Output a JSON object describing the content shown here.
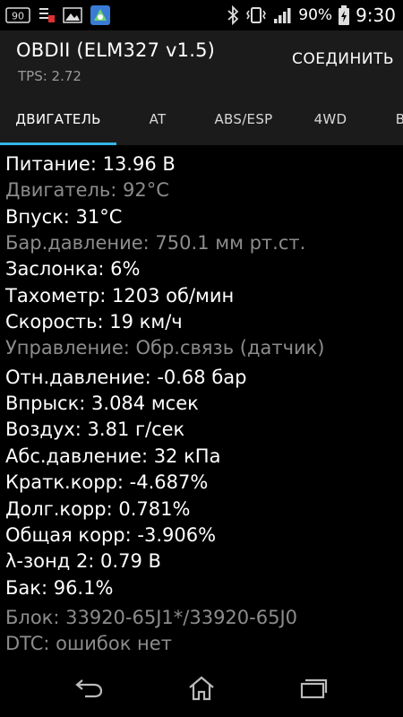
{
  "status_bar": {
    "battery_percent": "90%",
    "time": "9:30",
    "left_badge": "90"
  },
  "header": {
    "title": "OBDII (ELM327 v1.5)",
    "subtitle": "TPS: 2.72",
    "connect_label": "СОЕДИНИТЬ"
  },
  "tabs": [
    {
      "label": "ДВИГАТЕЛЬ",
      "active": true
    },
    {
      "label": "AT"
    },
    {
      "label": "ABS/ESP"
    },
    {
      "label": "4WD"
    },
    {
      "label": "B"
    }
  ],
  "params": [
    {
      "text": "Питание: 13.96 В",
      "dim": false
    },
    {
      "text": "Двигатель: 92°C",
      "dim": true
    },
    {
      "text": "Впуск: 31°C",
      "dim": false
    },
    {
      "text": "Бар.давление: 750.1 мм рт.ст.",
      "dim": true
    },
    {
      "text": "Заслонка: 6%",
      "dim": false
    },
    {
      "text": "Тахометр: 1203 об/мин",
      "dim": false
    },
    {
      "text": "Скорость: 19 км/ч",
      "dim": false
    },
    {
      "text": "Управление: Обр.связь (датчик)",
      "dim": true
    },
    {
      "text": "Отн.давление: -0.68 бар",
      "dim": false
    },
    {
      "text": "Впрыск: 3.084 мсек",
      "dim": false
    },
    {
      "text": "Воздух: 3.81 г/сек",
      "dim": false
    },
    {
      "text": "Абс.давление: 32 кПа",
      "dim": false
    },
    {
      "text": "Кратк.корр: -4.687%",
      "dim": false
    },
    {
      "text": "Долг.корр: 0.781%",
      "dim": false
    },
    {
      "text": "Общая корр: -3.906%",
      "dim": false
    },
    {
      "text": "λ-зонд 2: 0.79 В",
      "dim": false
    },
    {
      "text": "Бак: 96.1%",
      "dim": false
    },
    {
      "text": "Блок: 33920-65J1*/33920-65J0",
      "dim": true
    },
    {
      "text": "DTC: ошибок нет",
      "dim": true
    }
  ],
  "colors": {
    "accent": "#33b5e5",
    "bright_text": "#ffffff",
    "dim_text": "#8c8c8c"
  },
  "icons": {
    "status_left": [
      "sim-card-icon",
      "notification-icon",
      "image-icon",
      "app-icon"
    ],
    "status_right": [
      "bluetooth-icon",
      "vibrate-icon",
      "signal-icon",
      "battery-icon"
    ],
    "nav": [
      "back-icon",
      "home-icon",
      "recent-apps-icon"
    ]
  }
}
